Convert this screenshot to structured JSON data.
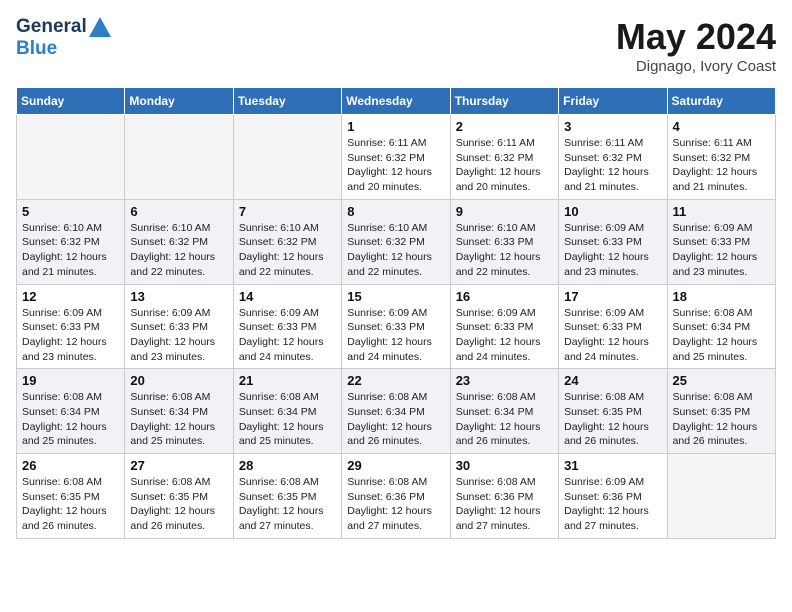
{
  "header": {
    "logo_line1": "General",
    "logo_line2": "Blue",
    "month": "May 2024",
    "location": "Dignago, Ivory Coast"
  },
  "days_of_week": [
    "Sunday",
    "Monday",
    "Tuesday",
    "Wednesday",
    "Thursday",
    "Friday",
    "Saturday"
  ],
  "weeks": [
    [
      {
        "day": "",
        "info": ""
      },
      {
        "day": "",
        "info": ""
      },
      {
        "day": "",
        "info": ""
      },
      {
        "day": "1",
        "info": "Sunrise: 6:11 AM\nSunset: 6:32 PM\nDaylight: 12 hours\nand 20 minutes."
      },
      {
        "day": "2",
        "info": "Sunrise: 6:11 AM\nSunset: 6:32 PM\nDaylight: 12 hours\nand 20 minutes."
      },
      {
        "day": "3",
        "info": "Sunrise: 6:11 AM\nSunset: 6:32 PM\nDaylight: 12 hours\nand 21 minutes."
      },
      {
        "day": "4",
        "info": "Sunrise: 6:11 AM\nSunset: 6:32 PM\nDaylight: 12 hours\nand 21 minutes."
      }
    ],
    [
      {
        "day": "5",
        "info": "Sunrise: 6:10 AM\nSunset: 6:32 PM\nDaylight: 12 hours\nand 21 minutes."
      },
      {
        "day": "6",
        "info": "Sunrise: 6:10 AM\nSunset: 6:32 PM\nDaylight: 12 hours\nand 22 minutes."
      },
      {
        "day": "7",
        "info": "Sunrise: 6:10 AM\nSunset: 6:32 PM\nDaylight: 12 hours\nand 22 minutes."
      },
      {
        "day": "8",
        "info": "Sunrise: 6:10 AM\nSunset: 6:32 PM\nDaylight: 12 hours\nand 22 minutes."
      },
      {
        "day": "9",
        "info": "Sunrise: 6:10 AM\nSunset: 6:33 PM\nDaylight: 12 hours\nand 22 minutes."
      },
      {
        "day": "10",
        "info": "Sunrise: 6:09 AM\nSunset: 6:33 PM\nDaylight: 12 hours\nand 23 minutes."
      },
      {
        "day": "11",
        "info": "Sunrise: 6:09 AM\nSunset: 6:33 PM\nDaylight: 12 hours\nand 23 minutes."
      }
    ],
    [
      {
        "day": "12",
        "info": "Sunrise: 6:09 AM\nSunset: 6:33 PM\nDaylight: 12 hours\nand 23 minutes."
      },
      {
        "day": "13",
        "info": "Sunrise: 6:09 AM\nSunset: 6:33 PM\nDaylight: 12 hours\nand 23 minutes."
      },
      {
        "day": "14",
        "info": "Sunrise: 6:09 AM\nSunset: 6:33 PM\nDaylight: 12 hours\nand 24 minutes."
      },
      {
        "day": "15",
        "info": "Sunrise: 6:09 AM\nSunset: 6:33 PM\nDaylight: 12 hours\nand 24 minutes."
      },
      {
        "day": "16",
        "info": "Sunrise: 6:09 AM\nSunset: 6:33 PM\nDaylight: 12 hours\nand 24 minutes."
      },
      {
        "day": "17",
        "info": "Sunrise: 6:09 AM\nSunset: 6:33 PM\nDaylight: 12 hours\nand 24 minutes."
      },
      {
        "day": "18",
        "info": "Sunrise: 6:08 AM\nSunset: 6:34 PM\nDaylight: 12 hours\nand 25 minutes."
      }
    ],
    [
      {
        "day": "19",
        "info": "Sunrise: 6:08 AM\nSunset: 6:34 PM\nDaylight: 12 hours\nand 25 minutes."
      },
      {
        "day": "20",
        "info": "Sunrise: 6:08 AM\nSunset: 6:34 PM\nDaylight: 12 hours\nand 25 minutes."
      },
      {
        "day": "21",
        "info": "Sunrise: 6:08 AM\nSunset: 6:34 PM\nDaylight: 12 hours\nand 25 minutes."
      },
      {
        "day": "22",
        "info": "Sunrise: 6:08 AM\nSunset: 6:34 PM\nDaylight: 12 hours\nand 26 minutes."
      },
      {
        "day": "23",
        "info": "Sunrise: 6:08 AM\nSunset: 6:34 PM\nDaylight: 12 hours\nand 26 minutes."
      },
      {
        "day": "24",
        "info": "Sunrise: 6:08 AM\nSunset: 6:35 PM\nDaylight: 12 hours\nand 26 minutes."
      },
      {
        "day": "25",
        "info": "Sunrise: 6:08 AM\nSunset: 6:35 PM\nDaylight: 12 hours\nand 26 minutes."
      }
    ],
    [
      {
        "day": "26",
        "info": "Sunrise: 6:08 AM\nSunset: 6:35 PM\nDaylight: 12 hours\nand 26 minutes."
      },
      {
        "day": "27",
        "info": "Sunrise: 6:08 AM\nSunset: 6:35 PM\nDaylight: 12 hours\nand 26 minutes."
      },
      {
        "day": "28",
        "info": "Sunrise: 6:08 AM\nSunset: 6:35 PM\nDaylight: 12 hours\nand 27 minutes."
      },
      {
        "day": "29",
        "info": "Sunrise: 6:08 AM\nSunset: 6:36 PM\nDaylight: 12 hours\nand 27 minutes."
      },
      {
        "day": "30",
        "info": "Sunrise: 6:08 AM\nSunset: 6:36 PM\nDaylight: 12 hours\nand 27 minutes."
      },
      {
        "day": "31",
        "info": "Sunrise: 6:09 AM\nSunset: 6:36 PM\nDaylight: 12 hours\nand 27 minutes."
      },
      {
        "day": "",
        "info": ""
      }
    ]
  ]
}
